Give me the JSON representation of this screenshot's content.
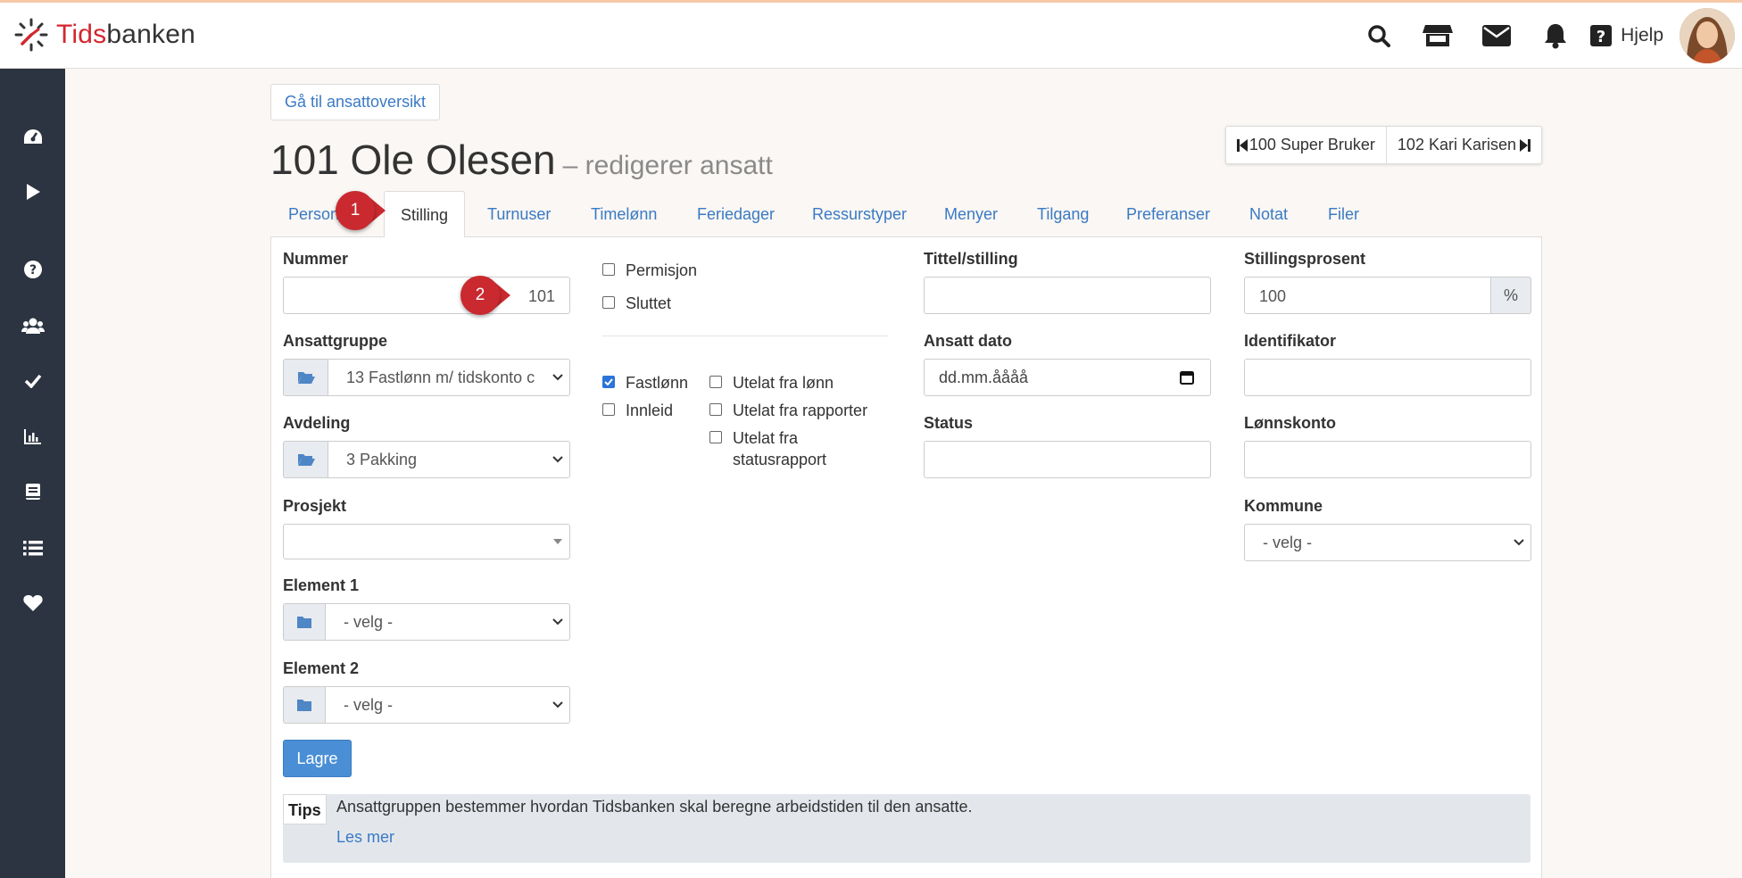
{
  "app": {
    "logo_prefix": "Tids",
    "logo_suffix": "banken",
    "help_label": "Hjelp",
    "icons": [
      "search-icon",
      "store-icon",
      "envelope-icon",
      "bell-icon",
      "question-icon"
    ]
  },
  "sidebar": {
    "items": [
      "dashboard-icon",
      "play-icon",
      "help-icon",
      "users-icon",
      "check-icon",
      "chart-icon",
      "book-icon",
      "list-icon",
      "heart-icon"
    ]
  },
  "header": {
    "back_button": "Gå til ansattoversikt",
    "title": "101 Ole Olesen",
    "subtitle": "– redigerer ansatt",
    "prev_employee": "100 Super Bruker",
    "next_employee": "102 Kari Karisen"
  },
  "tabs": [
    {
      "label": "Person"
    },
    {
      "label": "Stilling"
    },
    {
      "label": "Turnuser"
    },
    {
      "label": "Timelønn"
    },
    {
      "label": "Feriedager"
    },
    {
      "label": "Ressurstyper"
    },
    {
      "label": "Menyer"
    },
    {
      "label": "Tilgang"
    },
    {
      "label": "Preferanser"
    },
    {
      "label": "Notat"
    },
    {
      "label": "Filer"
    }
  ],
  "active_tab": "Stilling",
  "form": {
    "nummer": {
      "label": "Nummer",
      "value": "101"
    },
    "ansattgruppe": {
      "label": "Ansattgruppe",
      "value": "13 Fastlønn m/ tidskonto c"
    },
    "avdeling": {
      "label": "Avdeling",
      "value": "3 Pakking"
    },
    "prosjekt": {
      "label": "Prosjekt",
      "value": ""
    },
    "element1": {
      "label": "Element 1",
      "value": "- velg -"
    },
    "element2": {
      "label": "Element 2",
      "value": "- velg -"
    },
    "permisjon": {
      "label": "Permisjon",
      "checked": false
    },
    "sluttet": {
      "label": "Sluttet",
      "checked": false
    },
    "fastlonn": {
      "label": "Fastlønn",
      "checked": true
    },
    "innleid": {
      "label": "Innleid",
      "checked": false
    },
    "utelat_lonn": {
      "label": "Utelat fra lønn",
      "checked": false
    },
    "utelat_rapporter": {
      "label": "Utelat fra rapporter",
      "checked": false
    },
    "utelat_status_line1": "Utelat fra",
    "utelat_status_line2": "statusrapport",
    "tittel": {
      "label": "Tittel/stilling",
      "value": ""
    },
    "ansatt_dato": {
      "label": "Ansatt dato",
      "placeholder": "dd.mm.åååå"
    },
    "status": {
      "label": "Status",
      "value": ""
    },
    "stillingsprosent": {
      "label": "Stillingsprosent",
      "value": "100",
      "unit": "%"
    },
    "identifikator": {
      "label": "Identifikator",
      "value": ""
    },
    "lonnskonto": {
      "label": "Lønnskonto",
      "value": ""
    },
    "kommune": {
      "label": "Kommune",
      "value": "- velg -"
    },
    "save_label": "Lagre"
  },
  "tips": {
    "label": "Tips",
    "text": "Ansattgruppen bestemmer hvordan Tidsbanken skal beregne arbeidstiden til den ansatte.",
    "link": "Les mer"
  },
  "markers": [
    "1",
    "2"
  ],
  "colors": {
    "accent": "#3a7ac4",
    "marker": "#c9292f",
    "sidebar": "#2b3440",
    "save": "#4a8fd5"
  }
}
